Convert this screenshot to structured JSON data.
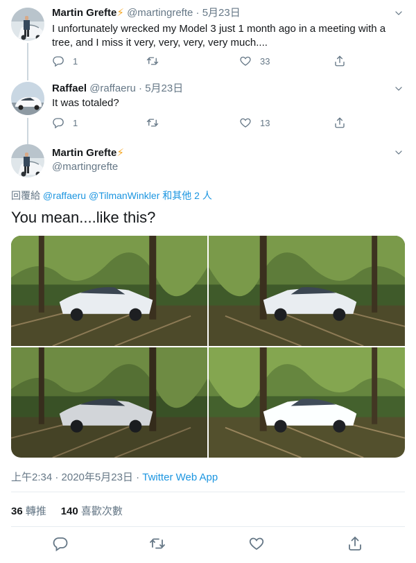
{
  "tweets": [
    {
      "name": "Martin Grefte",
      "bolt": "⚡",
      "handle": "@martingrefte",
      "dot": "·",
      "date": "5月23日",
      "text": "I unfortunately wrecked my Model 3 just 1 month ago in a meeting with a tree, and I miss it very, very, very, very much....",
      "replies": "1",
      "retweets": "",
      "likes": "33"
    },
    {
      "name": "Raffael",
      "bolt": "",
      "handle": "@raffaeru",
      "dot": "·",
      "date": "5月23日",
      "text": "It was totaled?",
      "replies": "1",
      "retweets": "",
      "likes": "13"
    }
  ],
  "main_tweet": {
    "name": "Martin Grefte",
    "bolt": "⚡",
    "handle": "@martingrefte",
    "reply_prefix": "回覆給",
    "reply_user1": "@raffaeru",
    "reply_user2": "@TilmanWinkler",
    "reply_suffix": "和其他 2 人",
    "text": "You mean....like this?",
    "time": "上午2:34 · 2020年5月23日 · ",
    "source": "Twitter Web App",
    "retweet_count": "36",
    "retweet_label": "轉推",
    "like_count": "140",
    "like_label": "喜歡次數"
  },
  "icons": [
    "reply-icon",
    "retweet-icon",
    "like-icon",
    "share-icon",
    "chevron-down-icon"
  ],
  "colors": {
    "link": "#1b95e0",
    "muted": "#657786",
    "text": "#14171a",
    "bolt": "#f5a623",
    "line": "#ccd6dd"
  }
}
